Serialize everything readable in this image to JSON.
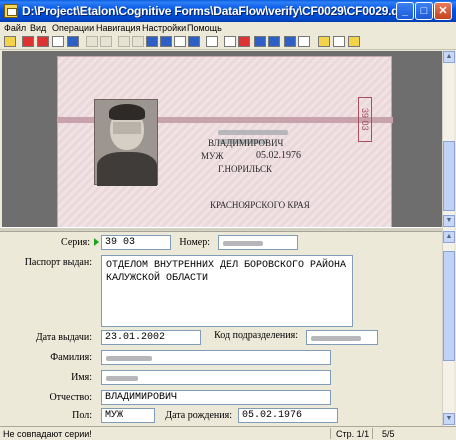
{
  "window": {
    "title": "D:\\Project\\Etalon\\Cognitive Forms\\DataFlow\\verify\\CF0029\\CF0029.d...",
    "minimize": "_",
    "maximize": "□",
    "close": "✕"
  },
  "menu": [
    "Файл",
    "Вид",
    "Операции",
    "Навигация",
    "Настройки",
    "Помощь"
  ],
  "toolbar_icons": [
    "open-icon",
    "save-icon",
    "save-red-icon",
    "print-icon",
    "scan-icon",
    "back-arrow-icon",
    "forward-arrow-icon",
    "page-first-icon",
    "page-prev-icon",
    "page-next-icon",
    "page-last-icon",
    "grid-icon",
    "settings-icon",
    "eye-icon",
    "stop-icon",
    "record-icon",
    "jump-icon",
    "export-icon",
    "export-alt-icon",
    "layout-icon",
    "bulb-icon",
    "note-icon",
    "window-icon"
  ],
  "document_image": {
    "patronymic": "ВЛАДИМИРОВИЧ",
    "sex": "МУЖ",
    "birth_date": "05.02.1976",
    "birth_place_1": "Г.НОРИЛЬСК",
    "birth_place_2": "КРАСНОЯРСКОГО КРАЯ",
    "series_vertical": "39 03"
  },
  "form": {
    "series_label": "Серия:",
    "series_value": "39 03",
    "number_label": "Номер:",
    "issued_by_label": "Паспорт выдан:",
    "issued_by_value": "ОТДЕЛОМ ВНУТРЕННИХ ДЕЛ БОРОВСКОГО РАЙОНА КАЛУЖСКОЙ ОБЛАСТИ",
    "issue_date_label": "Дата выдачи:",
    "issue_date_value": "23.01.2002",
    "division_code_label": "Код подразделения:",
    "surname_label": "Фамилия:",
    "name_label": "Имя:",
    "patronymic_label": "Отчество:",
    "patronymic_value": "ВЛАДИМИРОВИЧ",
    "sex_label": "Пол:",
    "sex_value": "МУЖ",
    "birth_date_label": "Дата рождения:",
    "birth_date_value": "05.02.1976"
  },
  "status": {
    "message": "Не совпадают серии!",
    "page": "Стр. 1/1",
    "record": "5/5"
  }
}
